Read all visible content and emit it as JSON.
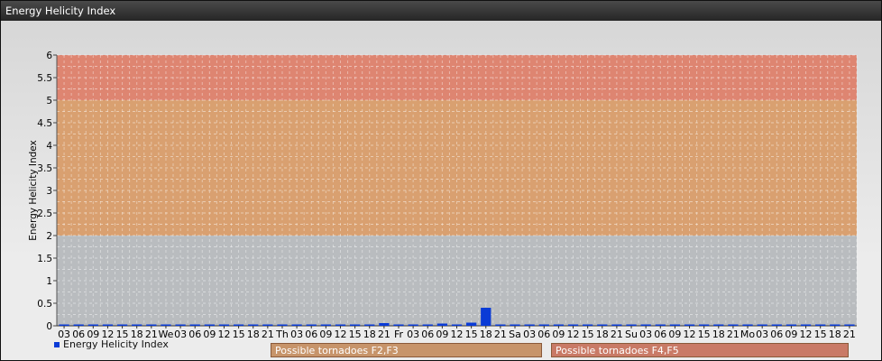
{
  "window": {
    "title": "Energy Helicity Index"
  },
  "legend": {
    "series_label": "Energy Helicity Index"
  },
  "bands": [
    {
      "label": "Possible tornadoes F2,F3",
      "from": 2,
      "to": 5,
      "color": "#d9a070",
      "legend_color": "#c7946a"
    },
    {
      "label": "Possible tornadoes F4,F5",
      "from": 5,
      "to": 6,
      "color": "#de8571",
      "legend_color": "#c97a66"
    }
  ],
  "colors": {
    "bar": "#0a3bd6",
    "below_band": "#b9bcbf",
    "grid": "#ffffff"
  },
  "chart_data": {
    "type": "bar",
    "title": "",
    "ylabel": "Energy Helicity Index",
    "ylim": [
      0,
      6
    ],
    "yticks": [
      "0",
      "0.5",
      "1",
      "1.5",
      "2",
      "2.5",
      "3",
      "3.5",
      "4",
      "4.5",
      "5",
      "5.5",
      "6"
    ],
    "grid": true,
    "legend_position": "bottom-left",
    "categories": [
      "03",
      "06",
      "09",
      "12",
      "15",
      "18",
      "21",
      "We",
      "03",
      "06",
      "09",
      "12",
      "15",
      "18",
      "21",
      "Th",
      "03",
      "06",
      "09",
      "12",
      "15",
      "18",
      "21",
      "Fr",
      "03",
      "06",
      "09",
      "12",
      "15",
      "18",
      "21",
      "Sa",
      "03",
      "06",
      "09",
      "12",
      "15",
      "18",
      "21",
      "Su",
      "03",
      "06",
      "09",
      "12",
      "15",
      "18",
      "21",
      "Mo",
      "03",
      "06",
      "09",
      "12",
      "15",
      "18",
      "21"
    ],
    "series": [
      {
        "name": "Energy Helicity Index",
        "values": [
          0.01,
          0.01,
          0.01,
          0.01,
          0.02,
          0.02,
          0.02,
          0.02,
          0.01,
          0.01,
          0.01,
          0.02,
          0.03,
          0.01,
          0.01,
          0.02,
          0.01,
          0.01,
          0.01,
          0.01,
          0.01,
          0.01,
          0.06,
          0.01,
          0.01,
          0.01,
          0.05,
          0.03,
          0.07,
          0.4,
          0.01,
          0.01,
          0.01,
          0.01,
          0.01,
          0.01,
          0.01,
          0.01,
          0.01,
          0.01,
          0.01,
          0.01,
          0.01,
          0.02,
          0.01,
          0.01,
          0.01,
          0.01,
          0.01,
          0.01,
          0.01,
          0.01,
          0.01,
          0.01,
          0.01
        ]
      }
    ]
  }
}
